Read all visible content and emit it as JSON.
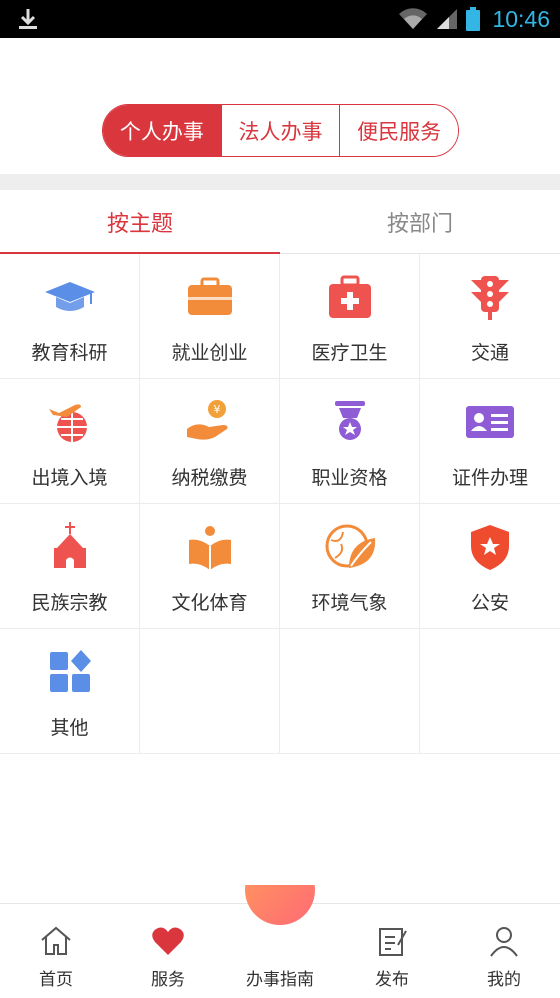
{
  "statusbar": {
    "time": "10:46"
  },
  "segments": [
    {
      "label": "个人办事",
      "active": true
    },
    {
      "label": "法人办事",
      "active": false
    },
    {
      "label": "便民服务",
      "active": false
    }
  ],
  "tabs": [
    {
      "label": "按主题",
      "active": true
    },
    {
      "label": "按部门",
      "active": false
    }
  ],
  "grid": [
    {
      "label": "教育科研",
      "icon": "graduation-cap-icon"
    },
    {
      "label": "就业创业",
      "icon": "briefcase-icon"
    },
    {
      "label": "医疗卫生",
      "icon": "medical-kit-icon"
    },
    {
      "label": "交通",
      "icon": "traffic-light-icon"
    },
    {
      "label": "出境入境",
      "icon": "airplane-globe-icon"
    },
    {
      "label": "纳税缴费",
      "icon": "hand-coin-icon"
    },
    {
      "label": "职业资格",
      "icon": "medal-icon"
    },
    {
      "label": "证件办理",
      "icon": "id-card-icon"
    },
    {
      "label": "民族宗教",
      "icon": "church-icon"
    },
    {
      "label": "文化体育",
      "icon": "reading-book-icon"
    },
    {
      "label": "环境气象",
      "icon": "leaf-globe-icon"
    },
    {
      "label": "公安",
      "icon": "police-shield-icon"
    },
    {
      "label": "其他",
      "icon": "apps-grid-icon"
    }
  ],
  "bottom_nav": [
    {
      "label": "首页",
      "icon": "home-icon"
    },
    {
      "label": "服务",
      "icon": "heart-icon",
      "active": true
    },
    {
      "label": "办事指南",
      "icon": "guide-fab-icon"
    },
    {
      "label": "发布",
      "icon": "edit-note-icon"
    },
    {
      "label": "我的",
      "icon": "user-icon"
    }
  ],
  "colors": {
    "accent": "#d9363e",
    "blue": "#5b8ee6",
    "orange": "#f28c3a",
    "red": "#ef5350",
    "purple": "#8e5dd6"
  }
}
